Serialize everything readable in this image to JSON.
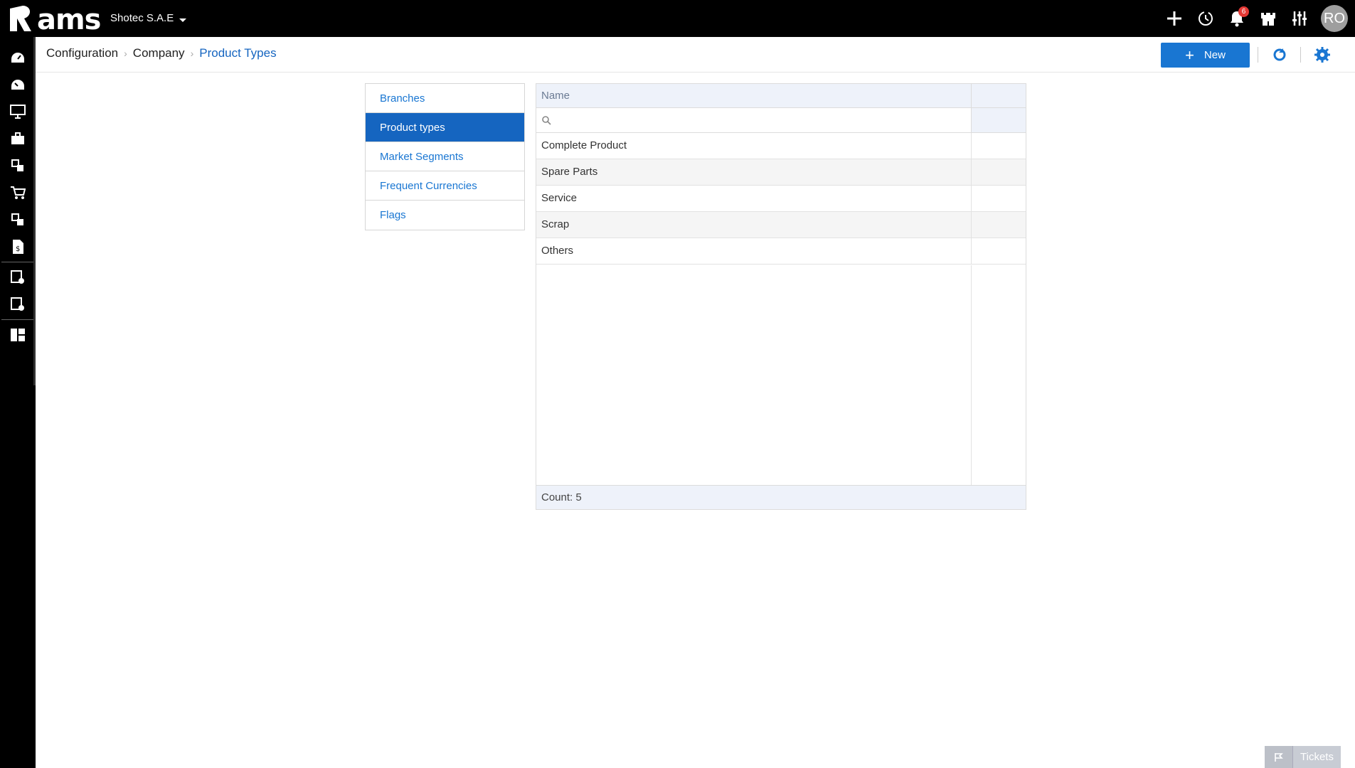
{
  "app": {
    "logo_text": "ams",
    "company": "Shotec S.A.E"
  },
  "topbar": {
    "notification_count": "6",
    "avatar_initials": "RO"
  },
  "breadcrumb": [
    "Configuration",
    "Company",
    "Product Types"
  ],
  "toolbar": {
    "new_label": "New"
  },
  "nav": {
    "items": [
      {
        "label": "Branches",
        "active": false
      },
      {
        "label": "Product types",
        "active": true
      },
      {
        "label": "Market Segments",
        "active": false
      },
      {
        "label": "Frequent Currencies",
        "active": false
      },
      {
        "label": "Flags",
        "active": false
      }
    ]
  },
  "grid": {
    "columns": [
      "Name"
    ],
    "rows": [
      "Complete Product",
      "Spare Parts",
      "Service",
      "Scrap",
      "Others"
    ],
    "footer": "Count: 5"
  },
  "tickets": {
    "label": "Tickets"
  },
  "colors": {
    "accent": "#1976d2",
    "active_nav": "#1565c0",
    "topbar": "#000000"
  }
}
